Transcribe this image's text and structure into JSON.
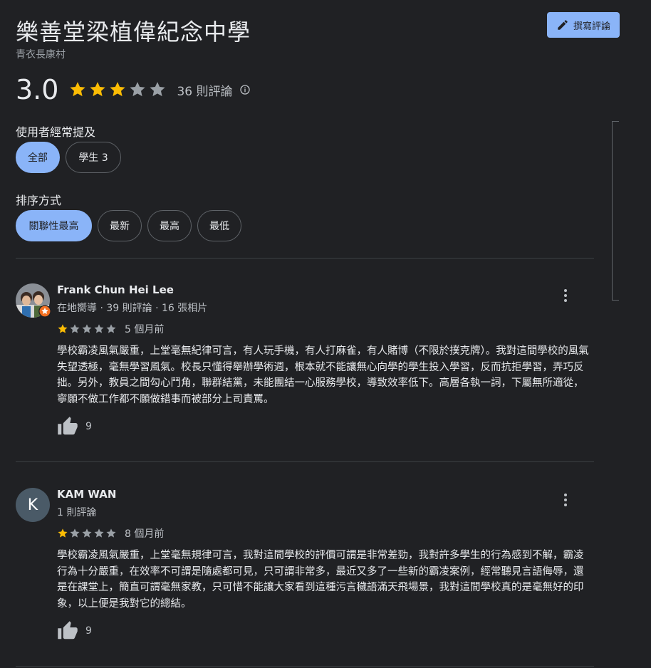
{
  "place": {
    "name": "樂善堂梁植偉紀念中學",
    "location": "青衣長康村"
  },
  "write_review_label": "撰寫評論",
  "summary": {
    "rating": "3.0",
    "stars": 3,
    "count_label": "36 則評論"
  },
  "topics": {
    "label": "使用者經常提及",
    "chips": [
      "全部",
      "學生 3"
    ],
    "selected": 0
  },
  "sort": {
    "label": "排序方式",
    "chips": [
      "關聯性最高",
      "最新",
      "最高",
      "最低"
    ],
    "selected": 0
  },
  "colors": {
    "accent": "#8ab4f8",
    "star_filled": "#fbbc04",
    "star_empty": "#9aa0a6",
    "background": "#202124"
  },
  "reviews": [
    {
      "name": "Frank Chun Hei Lee",
      "meta": "在地嚮導 · 39 則評論 · 16 張相片",
      "stars": 1,
      "date": "5 個月前",
      "text": "學校霸凌風氣嚴重，上堂毫無紀律可言，有人玩手機，有人打麻雀，有人賭博（不限於撲克牌）。我對這間學校的風氣失望透極，毫無學習風氣。校長只懂得舉辦學術週，根本就不能讓無心向學的學生投入學習，反而抗拒學習，弄巧反拙。另外，教員之間勾心鬥角，聯群結黨，未能團結一心服務學校，導致效率低下。高層各執一詞，下屬無所適從，寧願不做工作都不願做錯事而被部分上司責罵。",
      "likes": "9",
      "avatar_icon": "photo-avatar",
      "badge_icon": "local-guide-badge-icon"
    },
    {
      "name": "KAM WAN",
      "meta": "1 則評論",
      "stars": 1,
      "date": "8 個月前",
      "text": "學校霸凌風氣嚴重，上堂毫無規律可言，我對這間學校的評價可謂是非常差勁，我對許多學生的行為感到不解，霸凌行為十分嚴重，在效率不可謂是隨處都可見，只可謂非常多，最近又多了一些新的霸凌案例，經常聽見言語侮辱，還是在課堂上，簡直可謂毫無家教，只可惜不能讓大家看到這種污言穢語滿天飛場景，我對這間學校真的是毫無好的印象，以上便是我對它的總結。",
      "likes": "9",
      "avatar_letter": "K"
    }
  ]
}
